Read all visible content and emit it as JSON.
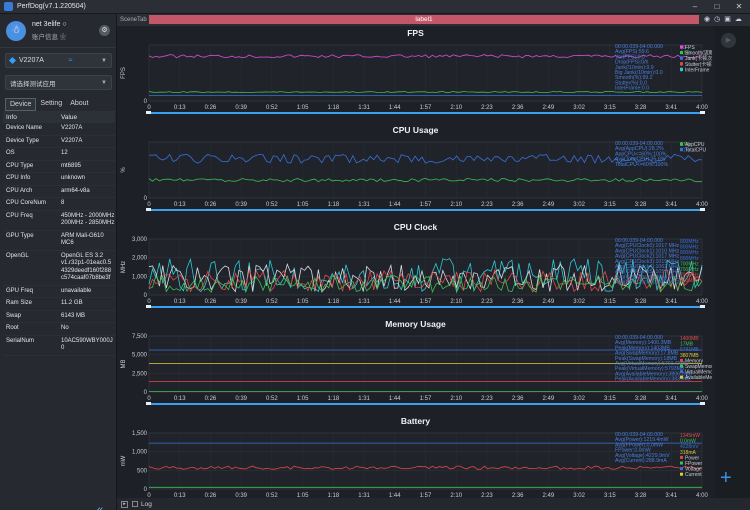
{
  "window": {
    "title": "PerfDog(v7.1.220504)"
  },
  "account": {
    "name": "net 3elife ○",
    "sub": "账户信息 ❀"
  },
  "device": {
    "name": "V2207A"
  },
  "app": {
    "placeholder": "请选择测试应用"
  },
  "tabs": [
    "Device",
    "Setting",
    "About"
  ],
  "info": {
    "header": {
      "k": "Info",
      "v": "Value"
    },
    "rows": [
      {
        "k": "Device Name",
        "v": "V2207A"
      },
      {
        "k": "Device Type",
        "v": "V2207A"
      },
      {
        "k": "OS",
        "v": "12"
      },
      {
        "k": "CPU Type",
        "v": "mt6895"
      },
      {
        "k": "CPU Info",
        "v": "unknown"
      },
      {
        "k": "CPU Arch",
        "v": "arm64-v8a"
      },
      {
        "k": "CPU CoreNum",
        "v": "8"
      },
      {
        "k": "CPU Freq",
        "v": "450MHz - 2000MHz\n200MHz - 2850MHz"
      },
      {
        "k": "GPU Type",
        "v": "ARM Mali-G610\nMC6"
      },
      {
        "k": "OpenGL",
        "v": "OpenGL ES 3.2\nv1.r32p1-01eac0.5\n4329deedf160f288\nc574caaf07b8be3f"
      },
      {
        "k": "GPU Freq",
        "v": "unavailable"
      },
      {
        "k": "Ram Size",
        "v": "11.2 GB"
      },
      {
        "k": "Swap",
        "v": "6143 MB"
      },
      {
        "k": "Root",
        "v": "No"
      },
      {
        "k": "SerialNum",
        "v": "10AC590WBY000J\n0"
      }
    ]
  },
  "scene": {
    "tab_label": "SceneTab",
    "label": "label1"
  },
  "bottom": {
    "log_label": "Log"
  },
  "timeline": [
    "0",
    "0:13",
    "0:26",
    "0:39",
    "0:52",
    "1:05",
    "1:18",
    "1:31",
    "1:44",
    "1:57",
    "2:10",
    "2:23",
    "2:36",
    "2:49",
    "3:02",
    "3:15",
    "3:28",
    "3:41",
    "4:00"
  ],
  "colors": {
    "fps": "#d84fd8",
    "green": "#3fbf4f",
    "blue": "#3a6fd8",
    "cyan": "#2ec9d6",
    "red": "#e04848",
    "yellow": "#e0c93a",
    "white": "#d9dde2",
    "pink": "#ff5f7a"
  },
  "panels": [
    {
      "title": "FPS",
      "ylabel": "FPS",
      "ymax": "",
      "ticks": [
        "",
        "0"
      ],
      "annot": [
        "00:00.039-04:00.000",
        "Avg(FPS):59.6",
        "Var(FPS):0.0",
        "Drop(FPS):0/h",
        "Jank(/10min):9.9",
        "Big Jank(/10min):0.0",
        "Smooth(%):99.2",
        "Stutter(%):0.0",
        "InterFrame:0.0"
      ],
      "legend": [
        {
          "v": "60",
          "c": "#d84fd8",
          "n": "FPS"
        },
        {
          "v": "4.99",
          "c": "#3fbf4f",
          "n": "Smooth(流畅度)"
        },
        {
          "v": "0",
          "c": "#3a6fd8",
          "n": "Jank(卡顿次数)"
        },
        {
          "v": "0",
          "c": "#e04848",
          "n": "Stutter(卡顿率)"
        },
        {
          "v": "0",
          "c": "#2ec9d6",
          "n": "InterFrame"
        }
      ]
    },
    {
      "title": "CPU Usage",
      "ylabel": "%",
      "ymax": "",
      "ticks": [
        "",
        "0"
      ],
      "annot": [
        "00:00.039-04:00.000",
        "Avg(AppCPU):28.2%",
        "AppCPU<=60%:100%",
        "Avg(TotalCPU):35.6%",
        "TotalCPU<=60%:100%"
      ],
      "legend": [
        {
          "v": "27%",
          "c": "#3fbf4f",
          "n": "AppCPU"
        },
        {
          "v": "61%",
          "c": "#3a6fd8",
          "n": "TotalCPU"
        }
      ]
    },
    {
      "title": "CPU Clock",
      "ylabel": "MHz",
      "ymax": "3,000",
      "ticks": [
        "3,000",
        "2,000",
        "1,000",
        "0"
      ],
      "annot": [
        "00:00.039-04:00.000",
        "Avg(CPUClock0):1017 MHz",
        "Avg(CPUClock1):1010 MHz",
        "Avg(CPUClock2):1017 MHz",
        "Avg(CPUClock3):1019 MHz",
        "Avg(CPUClock4):1062 MHz",
        "Avg(CPUClock5):1057 MHz",
        "Avg(CPUClock6):1054 MHz",
        "Avg(CPUClock7):1009 MHz"
      ],
      "legend": [
        {
          "v": "800MHz",
          "c": "#3a6fd8",
          "n": ""
        },
        {
          "v": "800MHz",
          "c": "#3a6fd8",
          "n": ""
        },
        {
          "v": "800MHz",
          "c": "#3a6fd8",
          "n": ""
        },
        {
          "v": "800MHz",
          "c": "#3a6fd8",
          "n": ""
        },
        {
          "v": "700MHz",
          "c": "#3fbf4f",
          "n": ""
        },
        {
          "v": "700MHz",
          "c": "#3fbf4f",
          "n": ""
        },
        {
          "v": "700MHz",
          "c": "#e04848",
          "n": ""
        },
        {
          "v": "800MHz",
          "c": "#e04848",
          "n": ""
        }
      ]
    },
    {
      "title": "Memory Usage",
      "ylabel": "MB",
      "ymax": "7,500",
      "ticks": [
        "7,500",
        "5,000",
        "2,500",
        "0"
      ],
      "annot": [
        "00:00.039-04:00.000",
        "Avg(Memory):1400.3MB",
        "Peak(Memory):1403MB",
        "Avg(SwapMemory):17.8MB",
        "Peak(SwapMemory):18MB",
        "Avg(VirtualMemory):5791.6MB",
        "Peak(VirtualMemory):5793MB",
        "Avg(AvailableMemory):3806.2MB",
        "Peak(AvailableMemory):3839MB"
      ],
      "legend": [
        {
          "v": "1400MB",
          "c": "#e04848",
          "n": ""
        },
        {
          "v": "17MB",
          "c": "#3fbf4f",
          "n": ""
        },
        {
          "v": "5791MB",
          "c": "#3a6fd8",
          "n": ""
        },
        {
          "v": "3807MB",
          "c": "#e0c93a",
          "n": ""
        },
        {
          "v": "",
          "c": "#e04848",
          "n": "Memory"
        },
        {
          "v": "",
          "c": "#3fbf4f",
          "n": "SwapMemory"
        },
        {
          "v": "",
          "c": "#3a6fd8",
          "n": "VirtualMemory"
        },
        {
          "v": "",
          "c": "#e0c93a",
          "n": "AvailableMemory"
        }
      ]
    },
    {
      "title": "Battery",
      "ylabel": "mW",
      "ymax": "",
      "ticks": [
        "1,500",
        "1,000",
        "500",
        "0"
      ],
      "annot": [
        "00:00.039-04:00.000",
        "Avg(Power):1219.4mW",
        "Avg(FPower):0.0mW",
        "FPower:0.0mW",
        "Avg(Voltage):4229.9mV",
        "Avg(Current):288.9mA"
      ],
      "legend": [
        {
          "v": "1345mW",
          "c": "#e04848",
          "n": ""
        },
        {
          "v": "0.0mW",
          "c": "#3fbf4f",
          "n": ""
        },
        {
          "v": "4228mV",
          "c": "#3a6fd8",
          "n": ""
        },
        {
          "v": "318mA",
          "c": "#e0c93a",
          "n": ""
        },
        {
          "v": "",
          "c": "#e04848",
          "n": "Power"
        },
        {
          "v": "",
          "c": "#3fbf4f",
          "n": "FPower"
        },
        {
          "v": "",
          "c": "#3a6fd8",
          "n": "Voltage"
        },
        {
          "v": "",
          "c": "#e0c93a",
          "n": "Current"
        }
      ]
    }
  ]
}
